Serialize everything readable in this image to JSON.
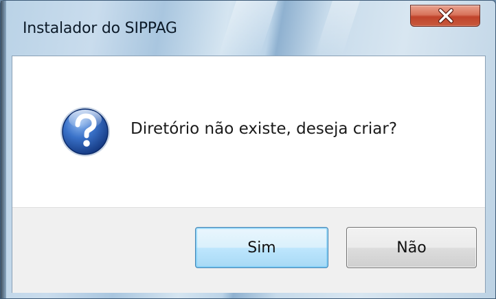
{
  "window": {
    "title": "Instalador do SIPPAG",
    "close_icon": "close-icon"
  },
  "dialog": {
    "icon": "question-icon",
    "message": "Diretório não existe, deseja criar?"
  },
  "buttons": {
    "yes_label": "Sim",
    "no_label": "Não"
  },
  "colors": {
    "close_button": "#c8452d",
    "question_icon": "#2a5db3",
    "default_button_border": "#3c7fb1",
    "footer_background": "#f0f0f0"
  }
}
